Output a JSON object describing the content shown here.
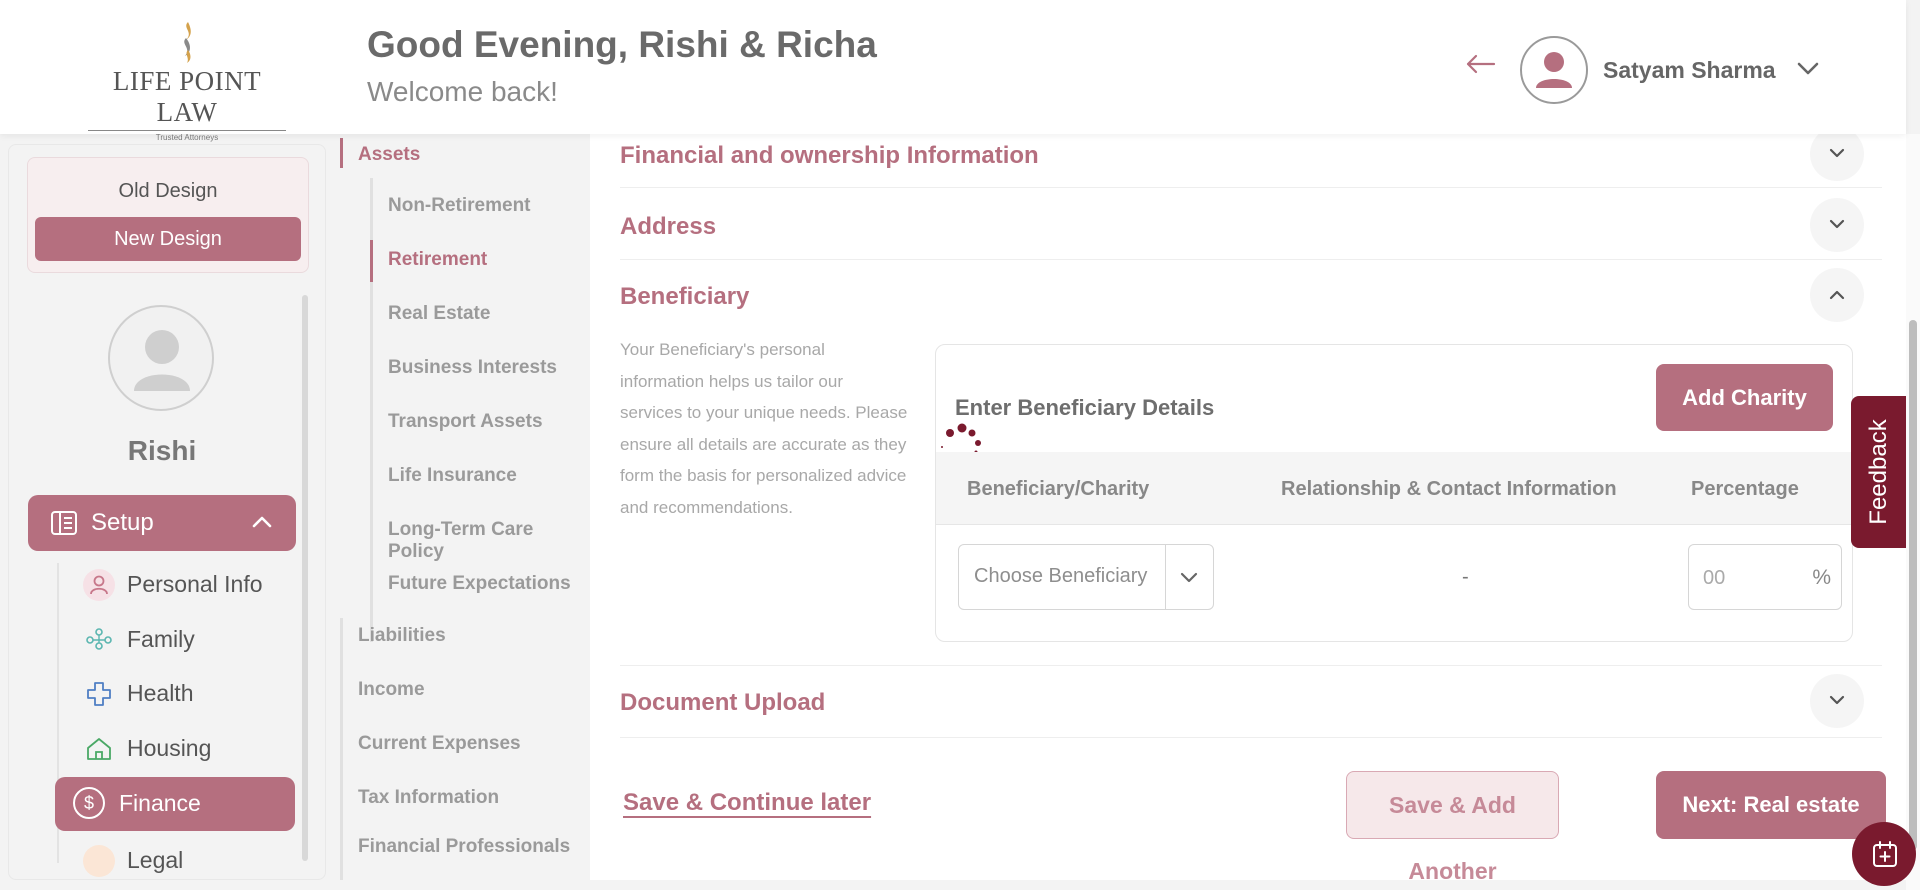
{
  "header": {
    "logo_text": "LIFE POINT LAW",
    "logo_tagline": "Trusted Attorneys",
    "greeting": "Good Evening, Rishi & Richa",
    "welcome": "Welcome back!",
    "user_name": "Satyam Sharma"
  },
  "sidebar": {
    "old_design": "Old Design",
    "new_design": "New Design",
    "profile_name": "Rishi",
    "setup_label": "Setup",
    "items": [
      {
        "label": "Personal Info",
        "icon": "person-icon",
        "color": "#c7778a"
      },
      {
        "label": "Family",
        "icon": "family-icon",
        "color": "#5bb6b0"
      },
      {
        "label": "Health",
        "icon": "health-cross-icon",
        "color": "#4f7fc4"
      },
      {
        "label": "Housing",
        "icon": "house-icon",
        "color": "#4aa866"
      },
      {
        "label": "Finance",
        "icon": "dollar-icon",
        "color": "#ffffff"
      },
      {
        "label": "Legal",
        "icon": "legal-icon",
        "color": "#e08a4a"
      }
    ]
  },
  "subnav": {
    "assets": "Assets",
    "asset_children": [
      "Non-Retirement",
      "Retirement",
      "Real Estate",
      "Business Interests",
      "Transport Assets",
      "Life Insurance",
      "Long-Term Care Policy",
      "Future Expectations"
    ],
    "active_child": "Retirement",
    "top_level": [
      "Liabilities",
      "Income",
      "Current Expenses",
      "Tax Information",
      "Financial Professionals"
    ]
  },
  "main": {
    "sections": {
      "financial": "Financial and ownership Information",
      "address": "Address",
      "beneficiary": "Beneficiary",
      "document_upload": "Document Upload"
    },
    "beneficiary_description": "Your Beneficiary's personal information helps us tailor our services to your unique needs. Please ensure all details are accurate as they form the basis for personalized advice and recommendations.",
    "card": {
      "title": "Enter Beneficiary Details",
      "add_charity": "Add Charity",
      "columns": [
        "Beneficiary/Charity",
        "Relationship & Contact Information",
        "Percentage"
      ],
      "select_placeholder": "Choose Beneficiary",
      "relationship_value": "-",
      "percentage_placeholder": "00",
      "percent_sign": "%"
    },
    "save_later": "Save & Continue later",
    "save_another": "Save & Add Another",
    "next": "Next: Real estate"
  },
  "feedback": "Feedback",
  "colors": {
    "accent": "#b56f7f",
    "dark_accent": "#7a1a2e"
  }
}
